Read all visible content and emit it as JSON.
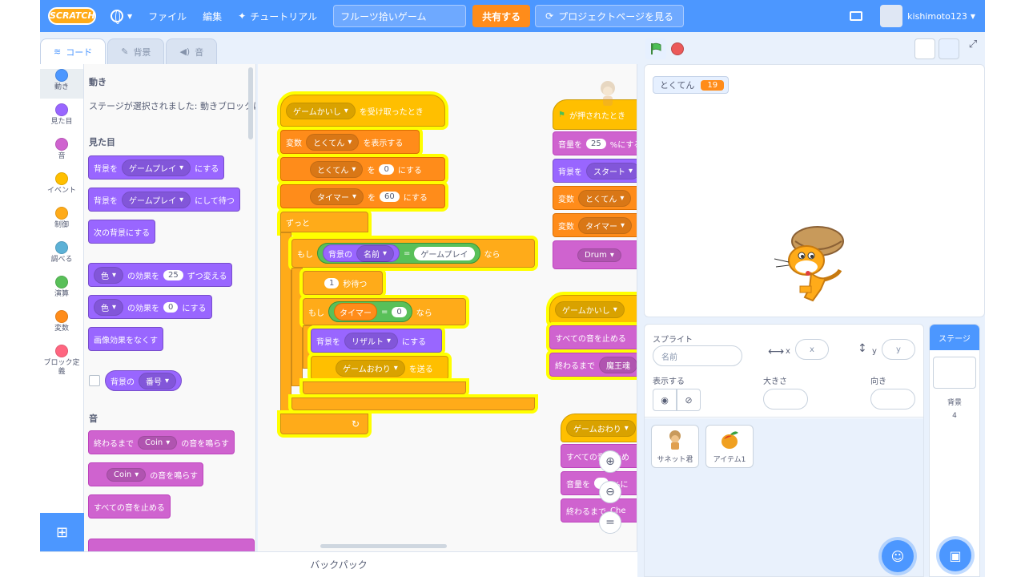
{
  "menubar": {
    "logo": "SCRATCH",
    "file": "ファイル",
    "edit": "編集",
    "tutorials": "チュートリアル",
    "project_title": "フルーツ拾いゲーム",
    "share": "共有する",
    "project_page": "プロジェクトページを見る",
    "username": "kishimoto123"
  },
  "tabs": {
    "code": "コード",
    "backdrops": "背景",
    "sounds": "音"
  },
  "categories": [
    {
      "label": "動き",
      "color": "#4c97ff"
    },
    {
      "label": "見た目",
      "color": "#9966ff"
    },
    {
      "label": "音",
      "color": "#cf63cf"
    },
    {
      "label": "イベント",
      "color": "#ffbf00"
    },
    {
      "label": "制御",
      "color": "#ffab19"
    },
    {
      "label": "調べる",
      "color": "#5cb1d6"
    },
    {
      "label": "演算",
      "color": "#59c059"
    },
    {
      "label": "変数",
      "color": "#ff8c1a"
    },
    {
      "label": "ブロック定義",
      "color": "#ff6680"
    }
  ],
  "flyout": {
    "motion_header": "動き",
    "motion_note": "ステージが選択されました: 動きブロックはありません",
    "looks_header": "見た目",
    "b_switch_backdrop": "背景を",
    "b_switch_backdrop_val": "ゲームプレイ",
    "b_switch_backdrop_end": "にする",
    "b_switch_wait": "背景を",
    "b_switch_wait_val": "ゲームプレイ",
    "b_switch_wait_end": "にして待つ",
    "b_next_backdrop": "次の背景にする",
    "b_change_effect_val": "色",
    "b_change_effect": "の効果を",
    "b_change_effect_num": "25",
    "b_change_effect_end": "ずつ変える",
    "b_set_effect_val": "色",
    "b_set_effect": "の効果を",
    "b_set_effect_num": "0",
    "b_set_effect_end": "にする",
    "b_clear_effects": "画像効果をなくす",
    "b_backdrop_num": "背景の",
    "b_backdrop_num_val": "番号",
    "sound_header": "音",
    "b_play_until": "終わるまで",
    "b_play_until_val": "Coin",
    "b_play_until_end": "の音を鳴らす",
    "b_start_sound_val": "Coin",
    "b_start_sound_end": "の音を鳴らす",
    "b_stop_sounds": "すべての音を止める"
  },
  "script1": {
    "hat_val": "ゲームかいし",
    "hat": "を受け取ったとき",
    "show_var": "変数",
    "show_var_val": "とくてん",
    "show_var_end": "を表示する",
    "set1_val": "とくてん",
    "set1_to": "を",
    "set1_num": "0",
    "set1_end": "にする",
    "set2_val": "タイマー",
    "set2_to": "を",
    "set2_num": "60",
    "set2_end": "にする",
    "forever": "ずっと",
    "if1": "もし",
    "if1_rep": "背景の",
    "if1_rep_val": "名前",
    "if1_eq": "=",
    "if1_str": "ゲームプレイ",
    "if1_then": "なら",
    "wait_num": "1",
    "wait": "秒待つ",
    "if2": "もし",
    "if2_rep": "タイマー",
    "if2_eq": "=",
    "if2_num": "0",
    "if2_then": "なら",
    "switch": "背景を",
    "switch_val": "リザルト",
    "switch_end": "にする",
    "broadcast_val": "ゲームおわり",
    "broadcast_end": "を送る"
  },
  "script2": {
    "flag_hat": "が押されたとき",
    "vol": "音量を",
    "vol_num": "25",
    "vol_end": "%にする",
    "bg": "背景を",
    "bg_val": "スタート",
    "var1": "変数",
    "var1_val": "とくてん",
    "var2": "変数",
    "var2_val": "タイマー",
    "drum_val": "Drum"
  },
  "script3": {
    "hat_val": "ゲームかいし",
    "stop_all": "すべての音を止める",
    "play_until": "終わるまで",
    "play_until_val": "魔王魂"
  },
  "script4": {
    "hat_val": "ゲームおわり",
    "stop_all": "すべての音を止め",
    "vol": "音量を",
    "vol_end": "%に",
    "play_until": "終わるまで",
    "play_until_val": "Che"
  },
  "backpack": "バックパック",
  "stage": {
    "monitor_label": "とくてん",
    "monitor_value": "19"
  },
  "sprite_info": {
    "sprite_label": "スプライト",
    "name_placeholder": "名前",
    "x_label": "x",
    "x_placeholder": "x",
    "y_label": "y",
    "y_placeholder": "y",
    "show_label": "表示する",
    "size_label": "大きさ",
    "direction_label": "向き"
  },
  "sprites": [
    {
      "name": "サネット君"
    },
    {
      "name": "アイテム1"
    }
  ],
  "stage_pane": {
    "title": "ステージ",
    "backdrops_label": "背景",
    "backdrops_count": "4"
  },
  "colors": {
    "accent": "#4c97ff",
    "share": "#ff8c1a",
    "glow": "#ffff00"
  }
}
